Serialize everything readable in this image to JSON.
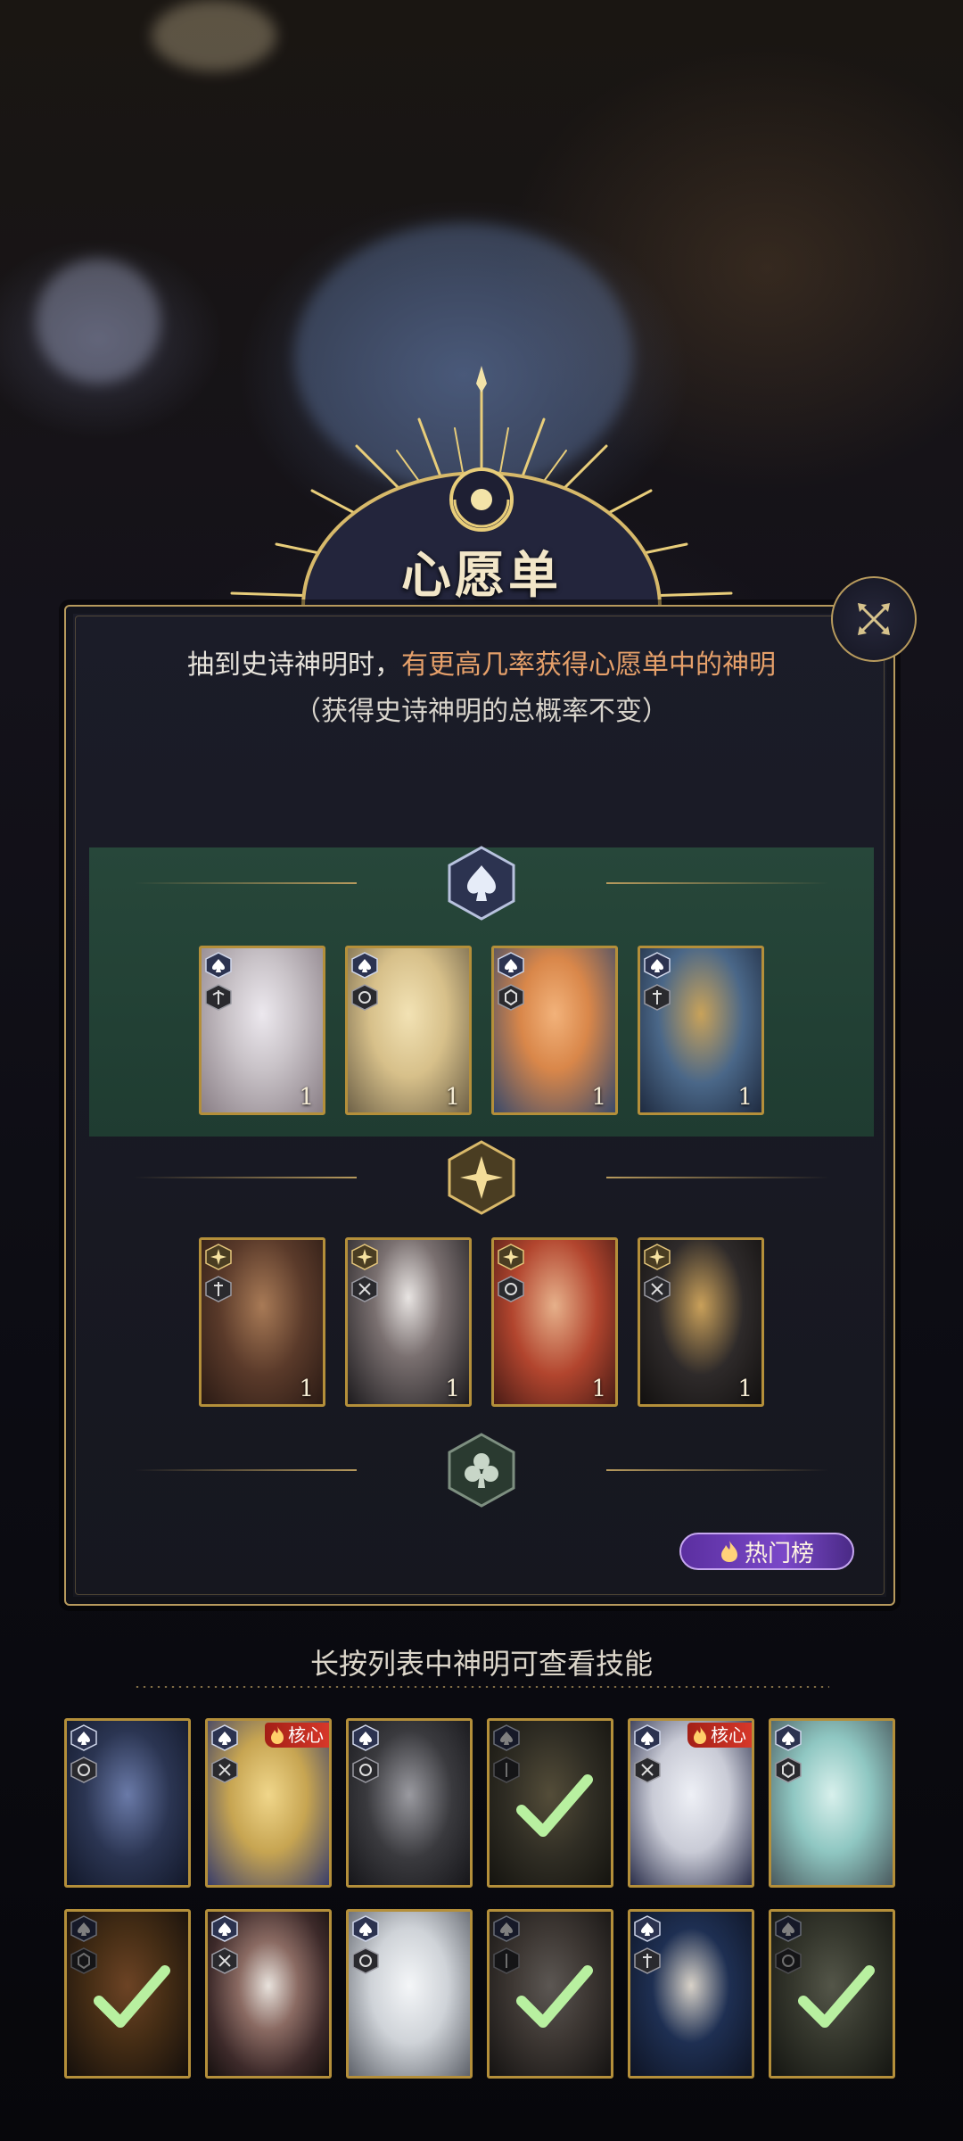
{
  "title": "心愿单",
  "description": {
    "part1": "抽到史诗神明时，",
    "highlight": "有更高几率获得心愿单中的神明",
    "line2": "（获得史诗神明的总概率不变）"
  },
  "colors": {
    "accent_gold": "#b79a5d",
    "highlight_text": "#e6a06a",
    "selected_row": "#27473a",
    "hot_button": "#7a48c8",
    "core_badge": "#d8382a"
  },
  "tiers": [
    {
      "icon": "spade-icon",
      "selected": true,
      "cards": [
        {
          "count": "1",
          "portrait": "#c9c3c8"
        },
        {
          "count": "1",
          "portrait": "#d7c08a"
        },
        {
          "count": "1",
          "portrait": "#d9874a"
        },
        {
          "count": "1",
          "portrait": "#4a6788"
        }
      ]
    },
    {
      "icon": "diamond-star-icon",
      "selected": false,
      "cards": [
        {
          "count": "1",
          "portrait": "#5a3a2a"
        },
        {
          "count": "1",
          "portrait": "#3b3336"
        },
        {
          "count": "1",
          "portrait": "#b2452e"
        },
        {
          "count": "1",
          "portrait": "#2e2a2a"
        }
      ]
    },
    {
      "icon": "club-icon",
      "selected": false,
      "cards": []
    }
  ],
  "hot_button": "热门榜",
  "hint": "长按列表中神明可查看技能",
  "roster": [
    {
      "portrait": "#2b3552",
      "core": false,
      "owned": false
    },
    {
      "portrait": "#c7a552",
      "core": true,
      "core_label": "核心",
      "owned": false
    },
    {
      "portrait": "#3a3a3e",
      "core": false,
      "owned": false
    },
    {
      "portrait": "#5f5a48",
      "core": false,
      "owned": true
    },
    {
      "portrait": "#c9cbd6",
      "core": true,
      "core_label": "核心",
      "owned": false
    },
    {
      "portrait": "#8fc7c2",
      "core": false,
      "owned": false
    },
    {
      "portrait": "#8a5a2a",
      "core": false,
      "owned": true
    },
    {
      "portrait": "#3d2a2a",
      "core": false,
      "owned": false
    },
    {
      "portrait": "#cfd3d8",
      "core": false,
      "owned": false
    },
    {
      "portrait": "#7a6e66",
      "core": false,
      "owned": true
    },
    {
      "portrait": "#1e2f52",
      "core": false,
      "owned": false
    },
    {
      "portrait": "#6a6e5a",
      "core": false,
      "owned": true
    }
  ]
}
